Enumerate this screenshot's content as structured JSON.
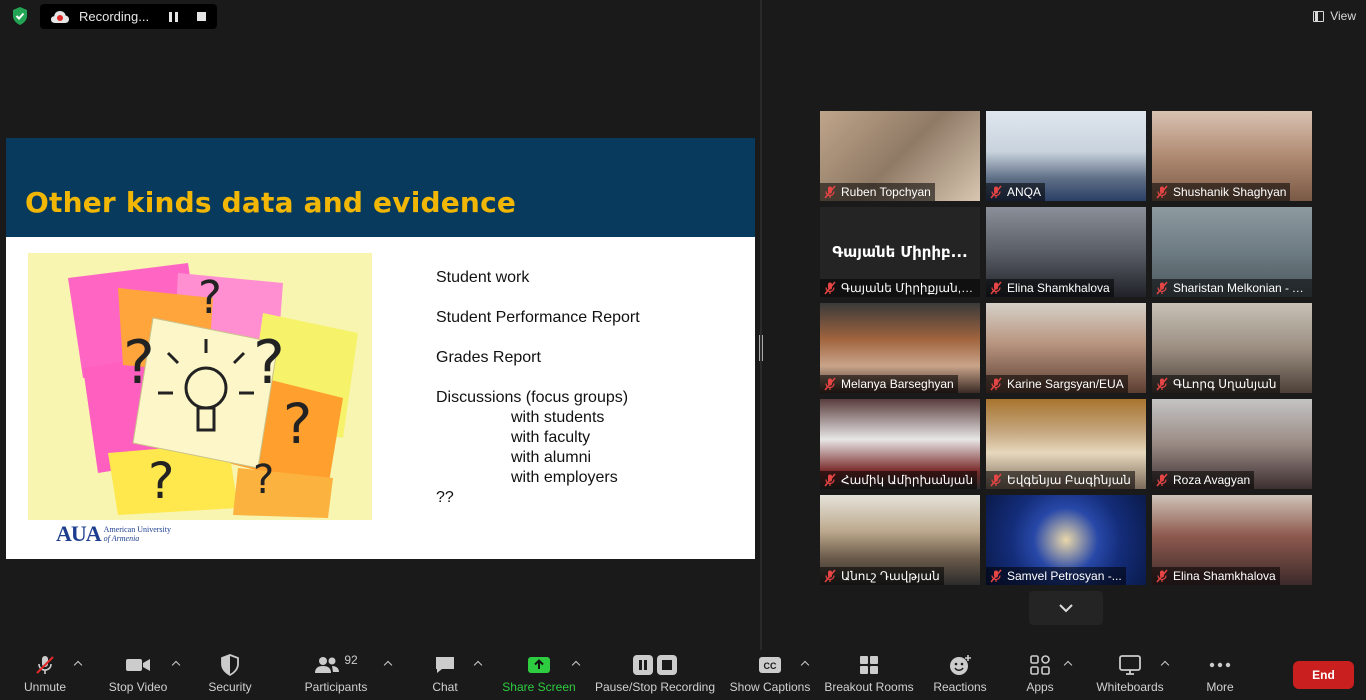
{
  "recording": {
    "label": "Recording..."
  },
  "view": {
    "label": "View"
  },
  "slide": {
    "title": "Other kinds data and evidence",
    "items": [
      "Student work",
      "Student Performance Report",
      "Grades Report",
      "Discussions (focus groups)"
    ],
    "subitems": [
      "with students",
      "with faculty",
      "with alumni",
      "with employers"
    ],
    "last": "??",
    "logo_mark": "AUA",
    "logo_line1": "American University",
    "logo_line2": "of Armenia"
  },
  "participants": [
    {
      "name": "Ruben Topchyan"
    },
    {
      "name": "ANQA"
    },
    {
      "name": "Shushanik Shaghyan"
    },
    {
      "name": "Գայանե Միրիքյան,Գ...",
      "display": "Գայանե Միրիբ..."
    },
    {
      "name": "Elina Shamkhalova"
    },
    {
      "name": "Sharistan Melkonian - A...",
      "active": true
    },
    {
      "name": "Melanya Barseghyan"
    },
    {
      "name": "Karine Sargsyan/EUA"
    },
    {
      "name": "Գևորգ Սղանյան"
    },
    {
      "name": "Համիկ Ամիրխանյան"
    },
    {
      "name": "Եվգենյա Բագինյան"
    },
    {
      "name": "Roza Avagyan"
    },
    {
      "name": "Անուշ Դավթյան"
    },
    {
      "name": "Samvel Petrosyan -..."
    },
    {
      "name": "Elina Shamkhalova"
    }
  ],
  "toolbar": {
    "unmute": "Unmute",
    "stop_video": "Stop Video",
    "security": "Security",
    "participants": "Participants",
    "participants_count": "92",
    "chat": "Chat",
    "share_screen": "Share Screen",
    "pause_stop_recording": "Pause/Stop Recording",
    "show_captions": "Show Captions",
    "breakout_rooms": "Breakout Rooms",
    "reactions": "Reactions",
    "apps": "Apps",
    "whiteboards": "Whiteboards",
    "more": "More",
    "end": "End"
  },
  "colors": {
    "accent_green": "#2ecc40",
    "end_red": "#c91f1f",
    "slide_header": "#073a5d",
    "slide_title": "#f2b705",
    "active_speaker": "#c9e267"
  }
}
